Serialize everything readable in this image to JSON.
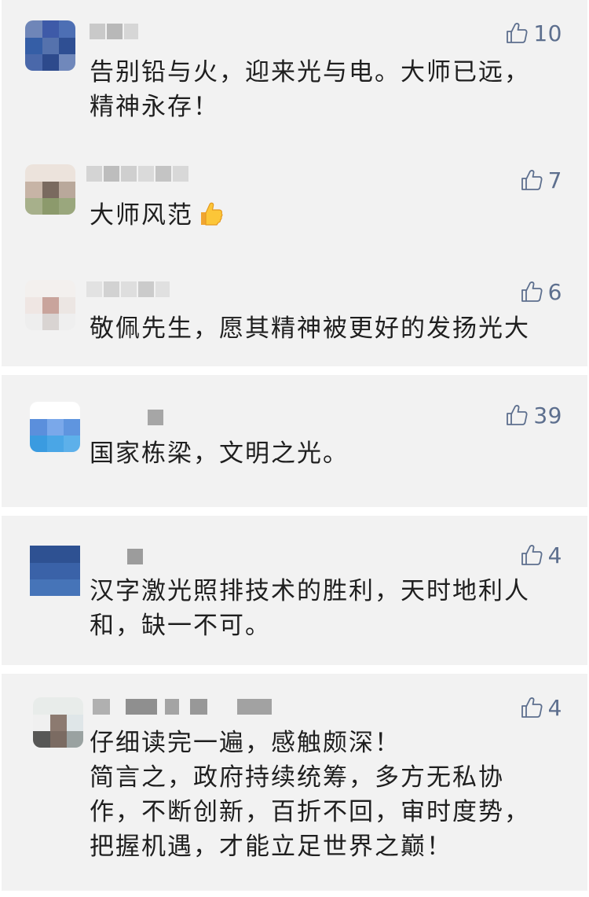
{
  "icons": {
    "like": "thumbs-up-outline-icon",
    "emoji": "thumbs-up-emoji-icon"
  },
  "colors": {
    "card_bg": "#f2f2f2",
    "like_count": "#5d6f8e",
    "text": "#1f1f1f"
  },
  "cards": [
    {
      "comments": [
        {
          "likes": "10",
          "lines": [
            "告别铅与火，迎来光与电。大师已远，",
            "精神永存！"
          ]
        },
        {
          "likes": "7",
          "lines": [
            "大师风范"
          ]
        },
        {
          "likes": "6",
          "lines": [
            "敬佩先生，愿其精神被更好的发扬光大"
          ]
        }
      ]
    },
    {
      "comments": [
        {
          "likes": "39",
          "lines": [
            "国家栋梁，文明之光。"
          ]
        }
      ]
    },
    {
      "comments": [
        {
          "likes": "4",
          "lines": [
            "汉字激光照排技术的胜利，天时地利人",
            "和，缺一不可。"
          ]
        }
      ]
    },
    {
      "comments": [
        {
          "likes": "4",
          "lines": [
            "仔细读完一遍，感触颇深！",
            "简言之，政府持续统筹，多方无私协",
            "作，不断创新，百折不回，审时度势，",
            "把握机遇，才能立足世界之巅！"
          ]
        }
      ]
    }
  ]
}
